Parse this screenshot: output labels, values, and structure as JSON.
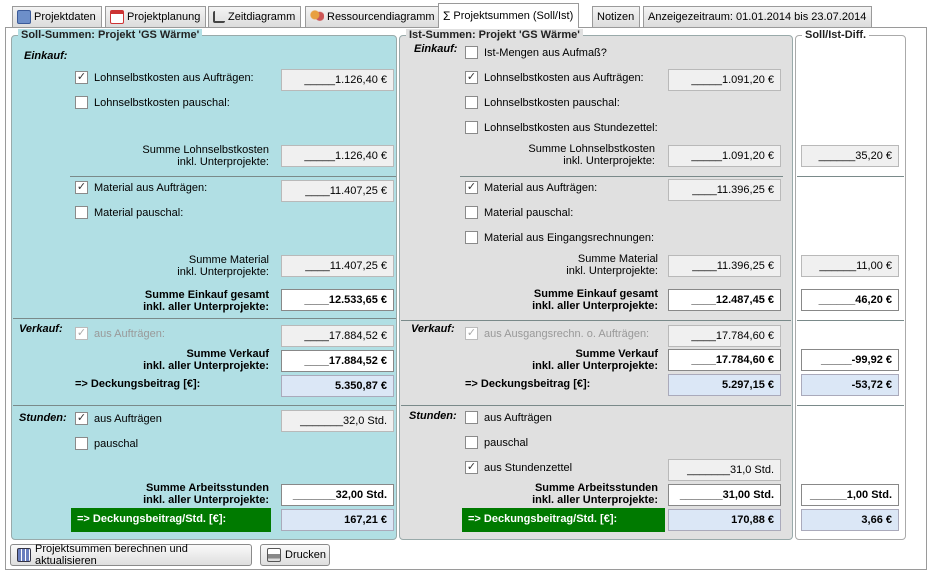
{
  "tabs": [
    {
      "label": "Projektdaten",
      "icon": "book-icon"
    },
    {
      "label": "Projektplanung",
      "icon": "calendar-icon"
    },
    {
      "label": "Zeitdiagramm",
      "icon": "chart-icon"
    },
    {
      "label": "Ressourcendiagramm",
      "icon": "people-icon"
    },
    {
      "label": "Projektsummen (Soll/Ist)",
      "icon": "sigma-icon",
      "active": true
    },
    {
      "label": "Notizen"
    },
    {
      "label": "Anzeigezeitraum: 01.01.2014 bis 23.07.2014"
    }
  ],
  "soll": {
    "title": "Soll-Summen: Projekt 'GS Wärme'",
    "einkauf_label": "Einkauf:",
    "lohn_auftraege": {
      "label": "Lohnselbstkosten aus Aufträgen:",
      "checked": true,
      "value": "_____1.126,40 €"
    },
    "lohn_pauschal": {
      "label": "Lohnselbstkosten pauschal:",
      "checked": false
    },
    "summe_lohn": {
      "label": "Summe Lohnselbstkosten\ninkl. Unterprojekte:",
      "value": "_____1.126,40 €"
    },
    "mat_auftraege": {
      "label": "Material aus Aufträgen:",
      "checked": true,
      "value": "____11.407,25 €"
    },
    "mat_pauschal": {
      "label": "Material pauschal:",
      "checked": false
    },
    "summe_mat": {
      "label": "Summe Material\ninkl. Unterprojekte:",
      "value": "____11.407,25 €"
    },
    "summe_einkauf": {
      "label": "Summe Einkauf gesamt\ninkl. aller Unterprojekte:",
      "value": "____12.533,65 €"
    },
    "verkauf_label": "Verkauf:",
    "verk_auftraege": {
      "label": "aus Aufträgen:",
      "value": "____17.884,52 €"
    },
    "summe_verkauf": {
      "label": "Summe Verkauf\ninkl. aller Unterprojekte:",
      "value": "____17.884,52 €"
    },
    "db": {
      "label": "=> Deckungsbeitrag [€]:",
      "value": "5.350,87 €"
    },
    "stunden_label": "Stunden:",
    "std_auftraege": {
      "label": "aus Aufträgen",
      "checked": true,
      "value": "_______32,0 Std."
    },
    "std_pauschal": {
      "label": "pauschal",
      "checked": false
    },
    "summe_std": {
      "label": "Summe Arbeitsstunden\ninkl. aller Unterprojekte:",
      "value": "_______32,00 Std."
    },
    "db_std": {
      "label": "=> Deckungsbeitrag/Std. [€]:",
      "value": "167,21 €"
    }
  },
  "ist": {
    "title": "Ist-Summen: Projekt 'GS Wärme'",
    "einkauf_label": "Einkauf:",
    "ist_mengen": {
      "label": "Ist-Mengen aus Aufmaß?",
      "checked": false
    },
    "lohn_auftraege": {
      "label": "Lohnselbstkosten aus Aufträgen:",
      "checked": true,
      "value": "_____1.091,20 €"
    },
    "lohn_pauschal": {
      "label": "Lohnselbstkosten pauschal:",
      "checked": false
    },
    "lohn_stundenzettel": {
      "label": "Lohnselbstkosten aus Stundezettel:",
      "checked": false
    },
    "summe_lohn": {
      "label": "Summe Lohnselbstkosten\ninkl. Unterprojekte:",
      "value": "_____1.091,20 €"
    },
    "mat_auftraege": {
      "label": "Material aus Aufträgen:",
      "checked": true,
      "value": "____11.396,25 €"
    },
    "mat_pauschal": {
      "label": "Material pauschal:",
      "checked": false
    },
    "mat_eingang": {
      "label": "Material aus Eingangsrechnungen:",
      "checked": false
    },
    "summe_mat": {
      "label": "Summe Material\ninkl. Unterprojekte:",
      "value": "____11.396,25 €"
    },
    "summe_einkauf": {
      "label": "Summe Einkauf gesamt\ninkl. aller Unterprojekte:",
      "value": "____12.487,45 €"
    },
    "verkauf_label": "Verkauf:",
    "verk_ausgang": {
      "label": "aus Ausgangsrechn. o. Aufträgen:",
      "value": "____17.784,60 €"
    },
    "summe_verkauf": {
      "label": "Summe Verkauf\ninkl. aller Unterprojekte:",
      "value": "____17.784,60 €"
    },
    "db": {
      "label": "=> Deckungsbeitrag [€]:",
      "value": "5.297,15 €"
    },
    "stunden_label": "Stunden:",
    "std_auftraege": {
      "label": "aus Aufträgen",
      "checked": false
    },
    "std_pauschal": {
      "label": "pauschal",
      "checked": false
    },
    "std_zettel": {
      "label": "aus Stundenzettel",
      "checked": true,
      "value": "_______31,0 Std."
    },
    "summe_std": {
      "label": "Summe Arbeitsstunden\ninkl. aller Unterprojekte:",
      "value": "_______31,00 Std."
    },
    "db_std": {
      "label": "=> Deckungsbeitrag/Std. [€]:",
      "value": "170,88 €"
    }
  },
  "diff": {
    "title": "Soll/Ist-Diff.",
    "lohn": "______35,20 €",
    "mat": "______11,00 €",
    "einkauf": "______46,20 €",
    "verkauf": "_____-99,92 €",
    "db": "-53,72 €",
    "std": "______1,00 Std.",
    "db_std": "3,66 €"
  },
  "buttons": {
    "recalc": "Projektsummen berechnen und aktualisieren",
    "print": "Drucken"
  }
}
